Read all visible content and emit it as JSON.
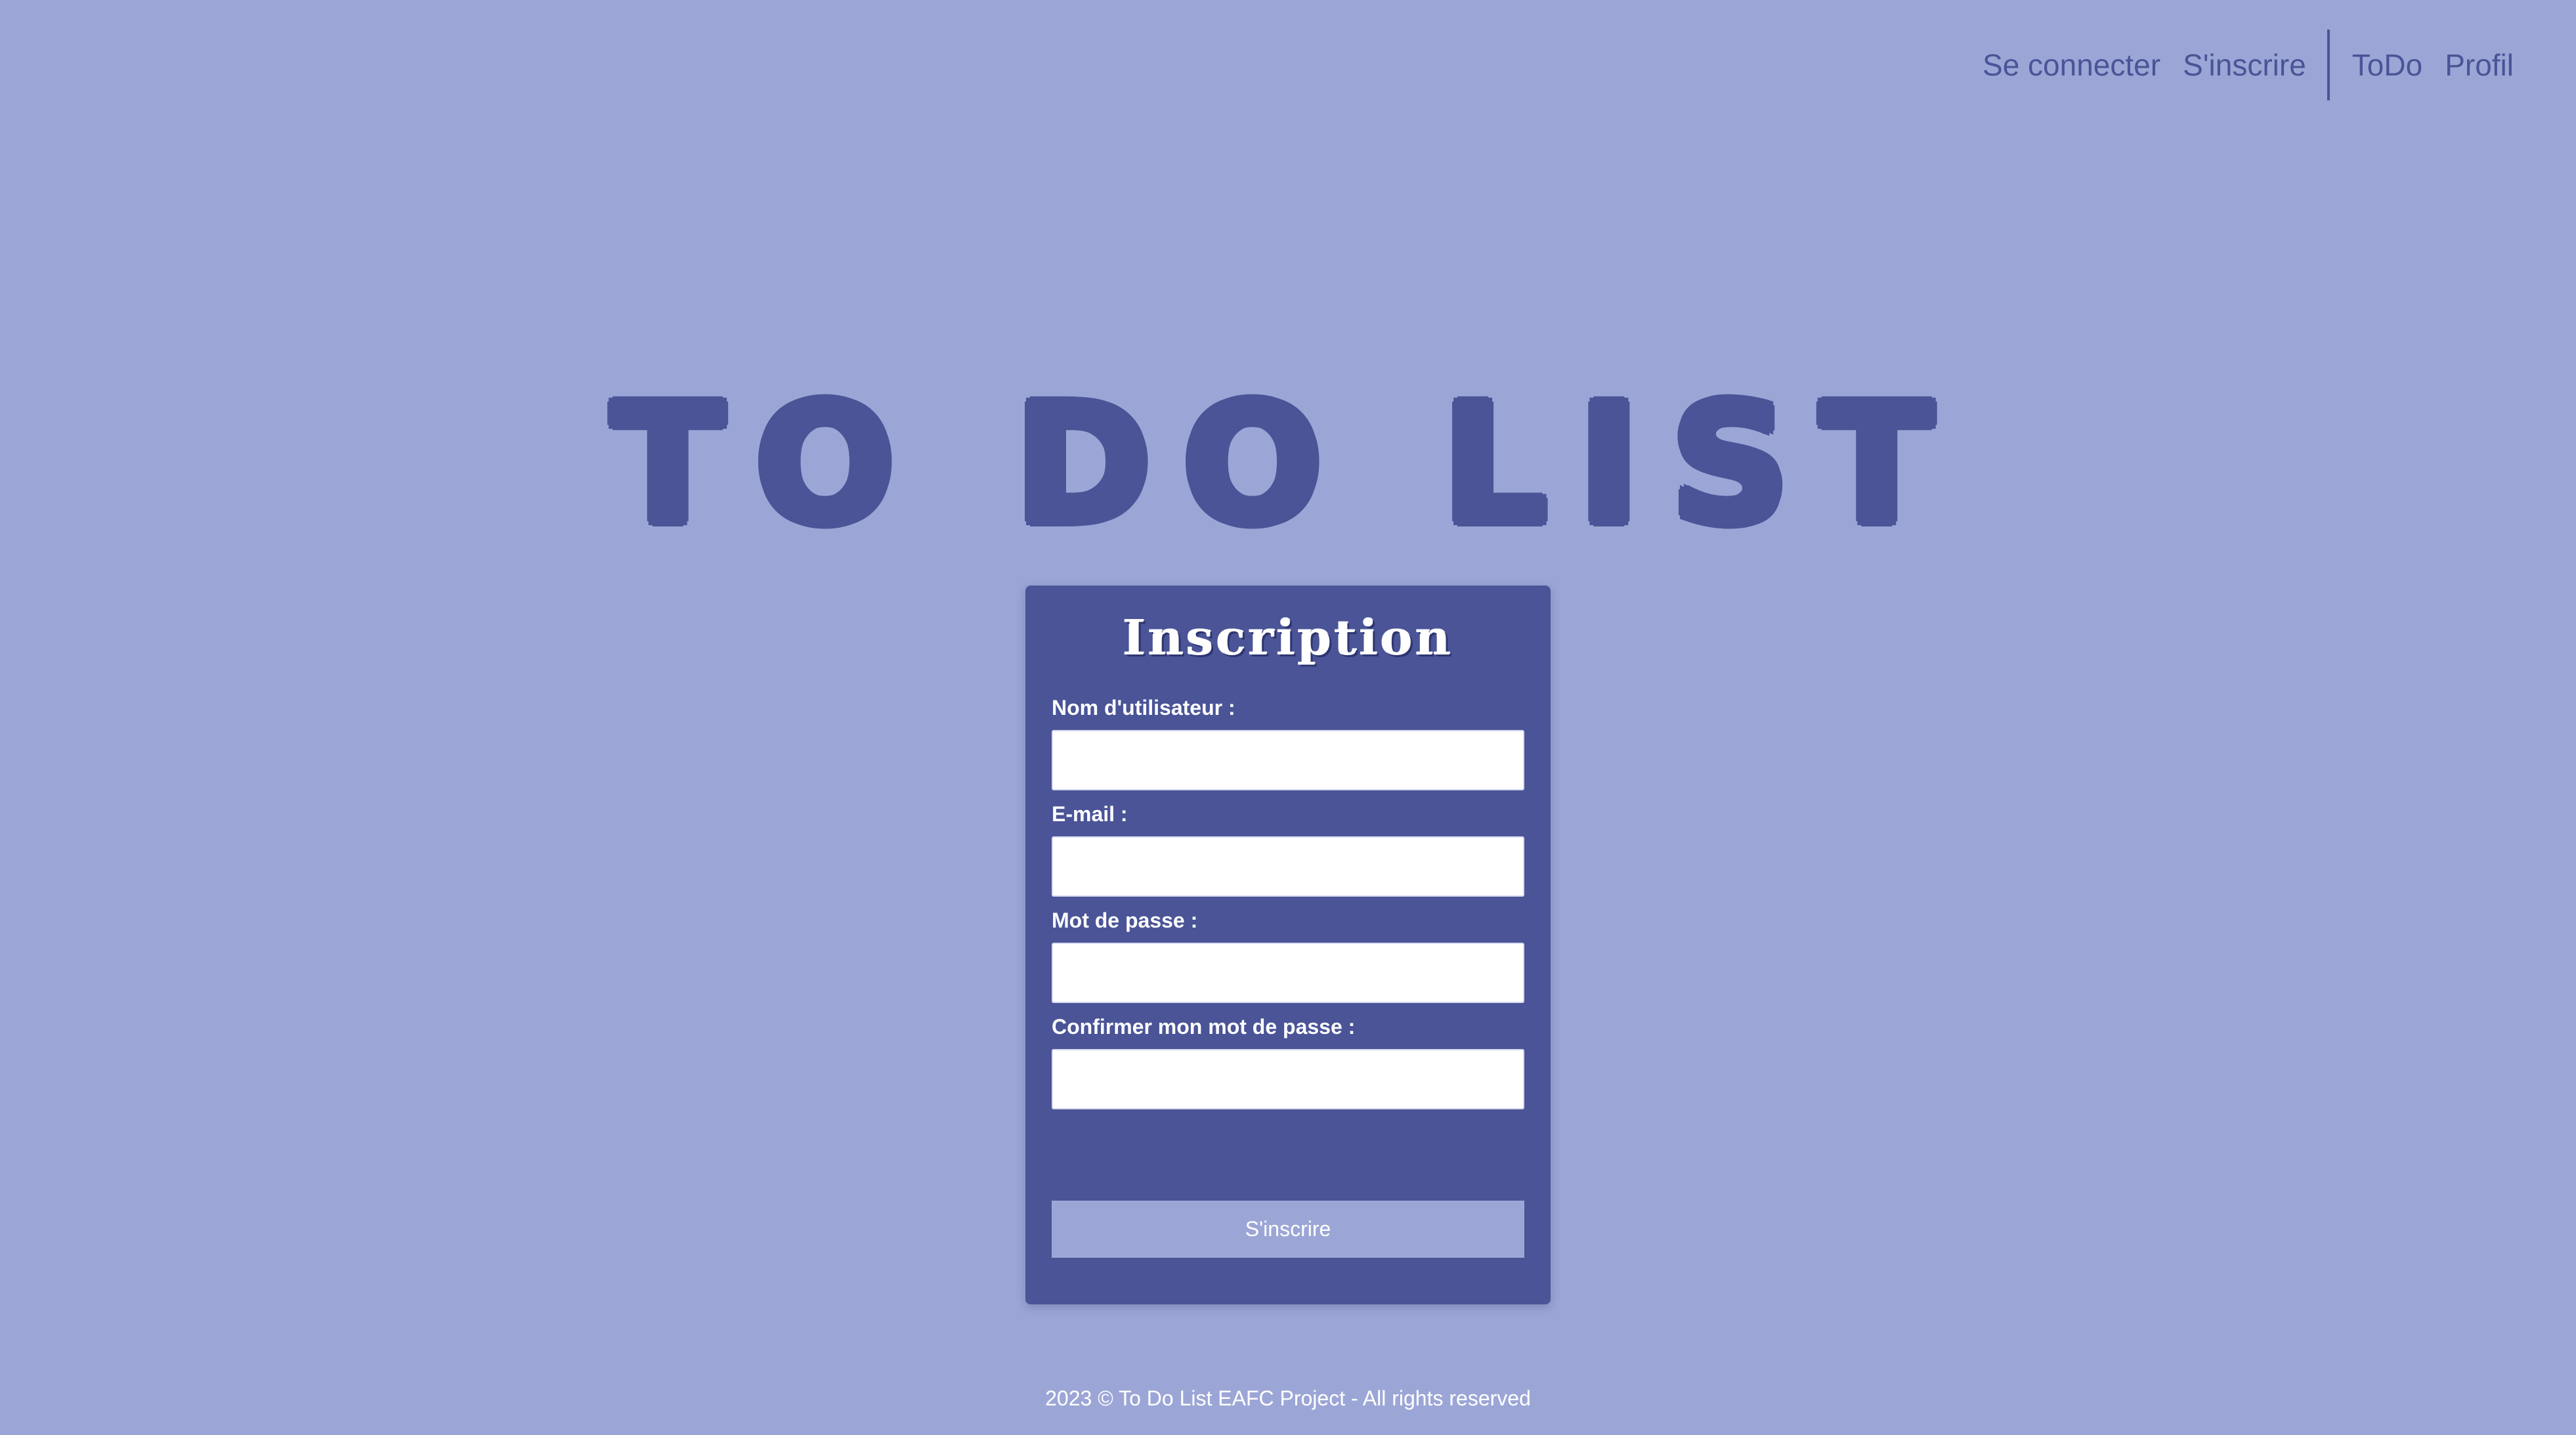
{
  "nav": {
    "login": "Se connecter",
    "register": "S'inscrire",
    "todo": "ToDo",
    "profile": "Profil"
  },
  "hero": {
    "title": "To Do List"
  },
  "form": {
    "title": "Inscription",
    "fields": [
      {
        "label": "Nom d'utilisateur :",
        "value": ""
      },
      {
        "label": "E-mail :",
        "value": ""
      },
      {
        "label": "Mot de passe :",
        "value": ""
      },
      {
        "label": "Confirmer mon mot de passe :",
        "value": ""
      }
    ],
    "submit_label": "S'inscrire"
  },
  "footer": {
    "text": "2023 © To Do List EAFC Project - All rights reserved"
  },
  "colors": {
    "background": "#9ca6d6",
    "accent": "#4a5497",
    "text_light": "#ffffff"
  }
}
